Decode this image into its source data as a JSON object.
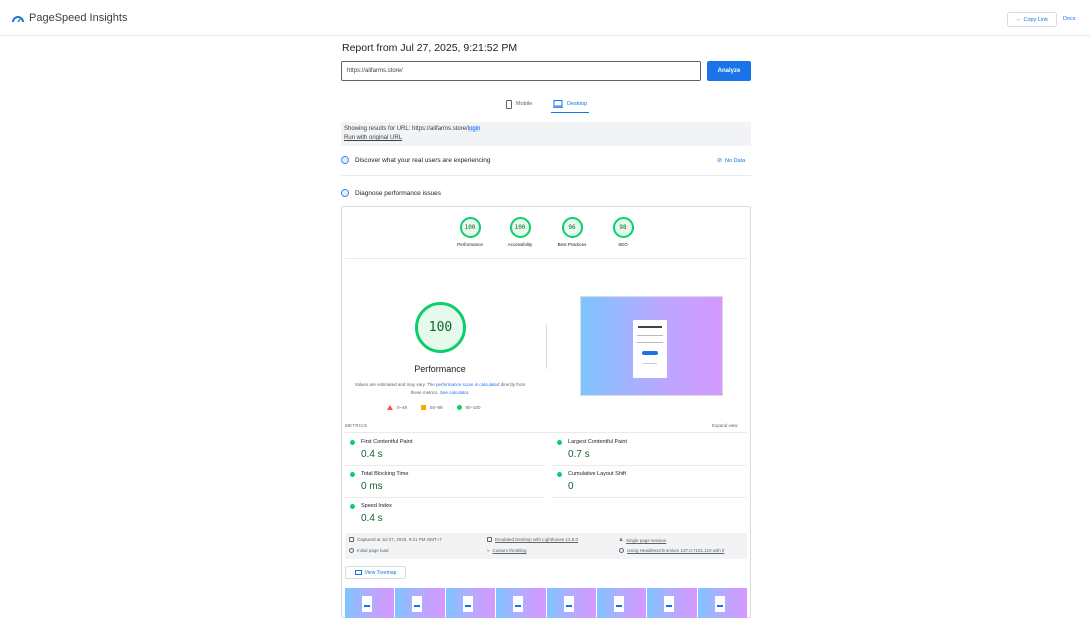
{
  "header": {
    "app_name": "PageSpeed Insights",
    "copy_link_label": "Copy Link",
    "docs_label": "Docs"
  },
  "report": {
    "title": "Report from Jul 27, 2025, 9:21:52 PM",
    "url_value": "https://alifarms.store/",
    "analyze_label": "Analyze",
    "tabs": {
      "mobile": "Mobile",
      "desktop": "Desktop",
      "selected": "Desktop"
    },
    "results_prefix": "Showing results for URL: https://alifarms.store/",
    "results_highlight": "login",
    "run_original": "Run with original URL"
  },
  "sections": {
    "discover": "Discover what your real users are experiencing",
    "no_data": "No Data",
    "diagnose": "Diagnose performance issues"
  },
  "scores": [
    {
      "label": "Performance",
      "value": "100"
    },
    {
      "label": "Accessibility",
      "value": "100"
    },
    {
      "label": "Best Practices",
      "value": "96"
    },
    {
      "label": "SEO",
      "value": "98"
    }
  ],
  "performance": {
    "score": "100",
    "title": "Performance",
    "note_part1": "Values are estimated and may vary. The ",
    "note_link1": "performance score is calculated",
    "note_part2": " directly from these metrics. ",
    "note_link2": "See calculator.",
    "legend_bad": "0–49",
    "legend_avg": "50–89",
    "legend_good": "90–100"
  },
  "screenshot_text": {
    "heading": "Spekti-HR Portal"
  },
  "metrics": {
    "header": "METRICS",
    "expand": "Expand view",
    "items": [
      {
        "name": "First Contentful Paint",
        "value": "0.4 s"
      },
      {
        "name": "Largest Contentful Paint",
        "value": "0.7 s"
      },
      {
        "name": "Total Blocking Time",
        "value": "0 ms"
      },
      {
        "name": "Cumulative Layout Shift",
        "value": "0"
      },
      {
        "name": "Speed Index",
        "value": "0.4 s"
      }
    ]
  },
  "info": {
    "captured": "Captured at Jul 27, 2025, 9:21 PM GMT+7",
    "initial_load": "Initial page load",
    "emulated": "Emulated Desktop with Lighthouse 12.8.0",
    "throttling": "Custom throttling",
    "session": "Single page session",
    "browser": "Using HeadlessChromium 137.0.7151.119 with lr"
  },
  "treemap_label": "View Treemap",
  "colors": {
    "accent": "#1a73e8",
    "good": "#0cce6b",
    "good_text": "#0d652d",
    "average": "#ffa400",
    "poor": "#ff4e42"
  }
}
